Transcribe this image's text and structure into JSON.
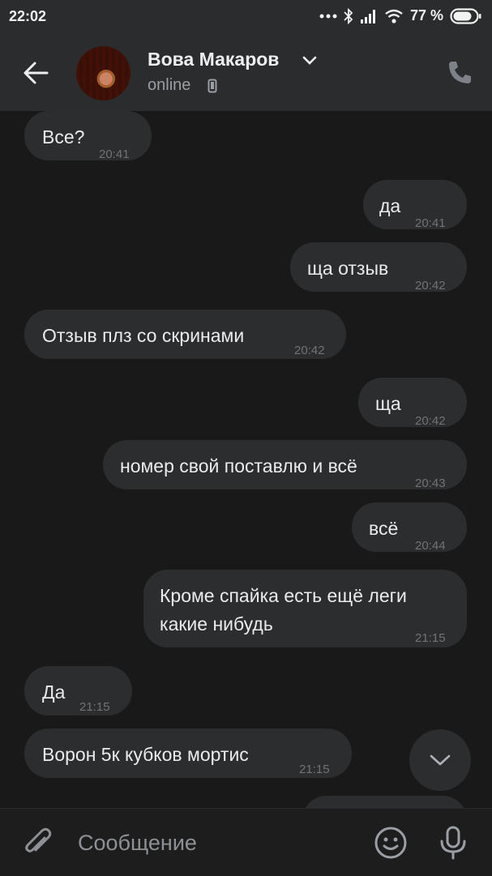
{
  "status_bar": {
    "time": "22:02",
    "battery_percent": "77 %",
    "icons": [
      "dots-icon",
      "bluetooth-icon",
      "signal-icon",
      "wifi-icon",
      "battery-icon"
    ]
  },
  "header": {
    "contact_name": "Вова Макаров",
    "status": "online",
    "icons": [
      "back-arrow-icon",
      "chevron-down-icon",
      "mobile-device-icon",
      "phone-icon"
    ]
  },
  "messages": [
    {
      "text": "Все?",
      "time": "20:41",
      "direction": "incoming"
    },
    {
      "text": "да",
      "time": "20:41",
      "direction": "outgoing"
    },
    {
      "text": "ща отзыв",
      "time": "20:42",
      "direction": "outgoing"
    },
    {
      "text": "Отзыв плз со скринами",
      "time": "20:42",
      "direction": "incoming"
    },
    {
      "text": "ща",
      "time": "20:42",
      "direction": "outgoing"
    },
    {
      "text": "номер свой поставлю и всё",
      "time": "20:43",
      "direction": "outgoing"
    },
    {
      "text": "всё",
      "time": "20:44",
      "direction": "outgoing"
    },
    {
      "line1": "Кроме спайка есть ещё леги",
      "line2": "какие нибудь",
      "time": "21:15",
      "direction": "outgoing"
    },
    {
      "text": "Да",
      "time": "21:15",
      "direction": "incoming"
    },
    {
      "text": "Ворон 5к кубков мортис",
      "time": "21:15",
      "direction": "incoming"
    }
  ],
  "input": {
    "placeholder": "Сообщение",
    "icons": [
      "paperclip-icon",
      "emoji-icon",
      "microphone-icon"
    ]
  },
  "colors": {
    "background": "#19191a",
    "header": "#2b2c2d",
    "bubble": "#2c2d2e",
    "text": "#e9ebee",
    "muted": "#6f7378"
  }
}
